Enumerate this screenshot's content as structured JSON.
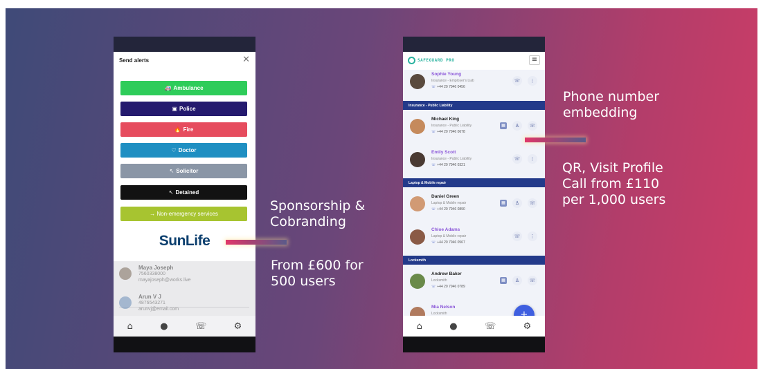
{
  "left_phone": {
    "modal_title": "Send alerts",
    "alert_buttons": [
      {
        "label": "Ambulance",
        "icon": "🚑",
        "color": "#2ecc5a"
      },
      {
        "label": "Police",
        "icon": "▣",
        "color": "#241a6e"
      },
      {
        "label": "Fire",
        "icon": "🔥",
        "color": "#e64c5e"
      },
      {
        "label": "Doctor",
        "icon": "♡",
        "color": "#1f8fc2"
      },
      {
        "label": "Solicitor",
        "icon": "↖",
        "color": "#8a96a6"
      },
      {
        "label": "Detained",
        "icon": "↖",
        "color": "#121212"
      },
      {
        "label": "→ Non-emergency services",
        "icon": "",
        "color": "#a7c430"
      }
    ],
    "sponsor_logo": "SunLife",
    "contacts": [
      {
        "name": "Maya Joseph",
        "phone": "7560338000",
        "email": "mayajoseph@works.live"
      },
      {
        "name": "Arun V J",
        "phone": "4876543271",
        "email": "arunvj@email.com"
      }
    ]
  },
  "right_phone": {
    "brand": "SAFEGUARD PRO",
    "sections": [
      {
        "title": "Insurance - Public Liability"
      },
      {
        "title": "Laptop & Mobile repair"
      },
      {
        "title": "Locksmith"
      }
    ],
    "contacts": [
      {
        "name": "Sophie Young",
        "category": "Insurance - Employer's Liab",
        "phone": "+44 20 7946 0456"
      },
      {
        "name": "Michael King",
        "category": "Insurance - Public Liability",
        "phone": "+44 20 7946 0678"
      },
      {
        "name": "Emily Scott",
        "category": "Insurance - Public Liability",
        "phone": "+44 20 7946 0321"
      },
      {
        "name": "Daniel Green",
        "category": "Laptop & Mobile repair",
        "phone": "+44 20 7946 0890"
      },
      {
        "name": "Chloe Adams",
        "category": "Laptop & Mobile repair",
        "phone": "+44 20 7946 0567"
      },
      {
        "name": "Andrew Baker",
        "category": "Locksmith",
        "phone": "+44 20 7946 0789"
      },
      {
        "name": "Mia Nelson",
        "category": "Locksmith",
        "phone": ""
      }
    ],
    "fab_label": "+"
  },
  "annotations": {
    "sponsorship_line1": "Sponsorship &",
    "sponsorship_line2": "Cobranding",
    "price_left_line1": "From £600 for",
    "price_left_line2": "500 users",
    "phone_embed_line1": "Phone number",
    "phone_embed_line2": "embedding",
    "qr_line1": "QR, Visit Profile",
    "qr_line2": "Call from £110",
    "qr_line3": "per 1,000 users"
  },
  "nav_icons": [
    "home-icon",
    "person-icon",
    "phone-icon",
    "settings-icon"
  ]
}
